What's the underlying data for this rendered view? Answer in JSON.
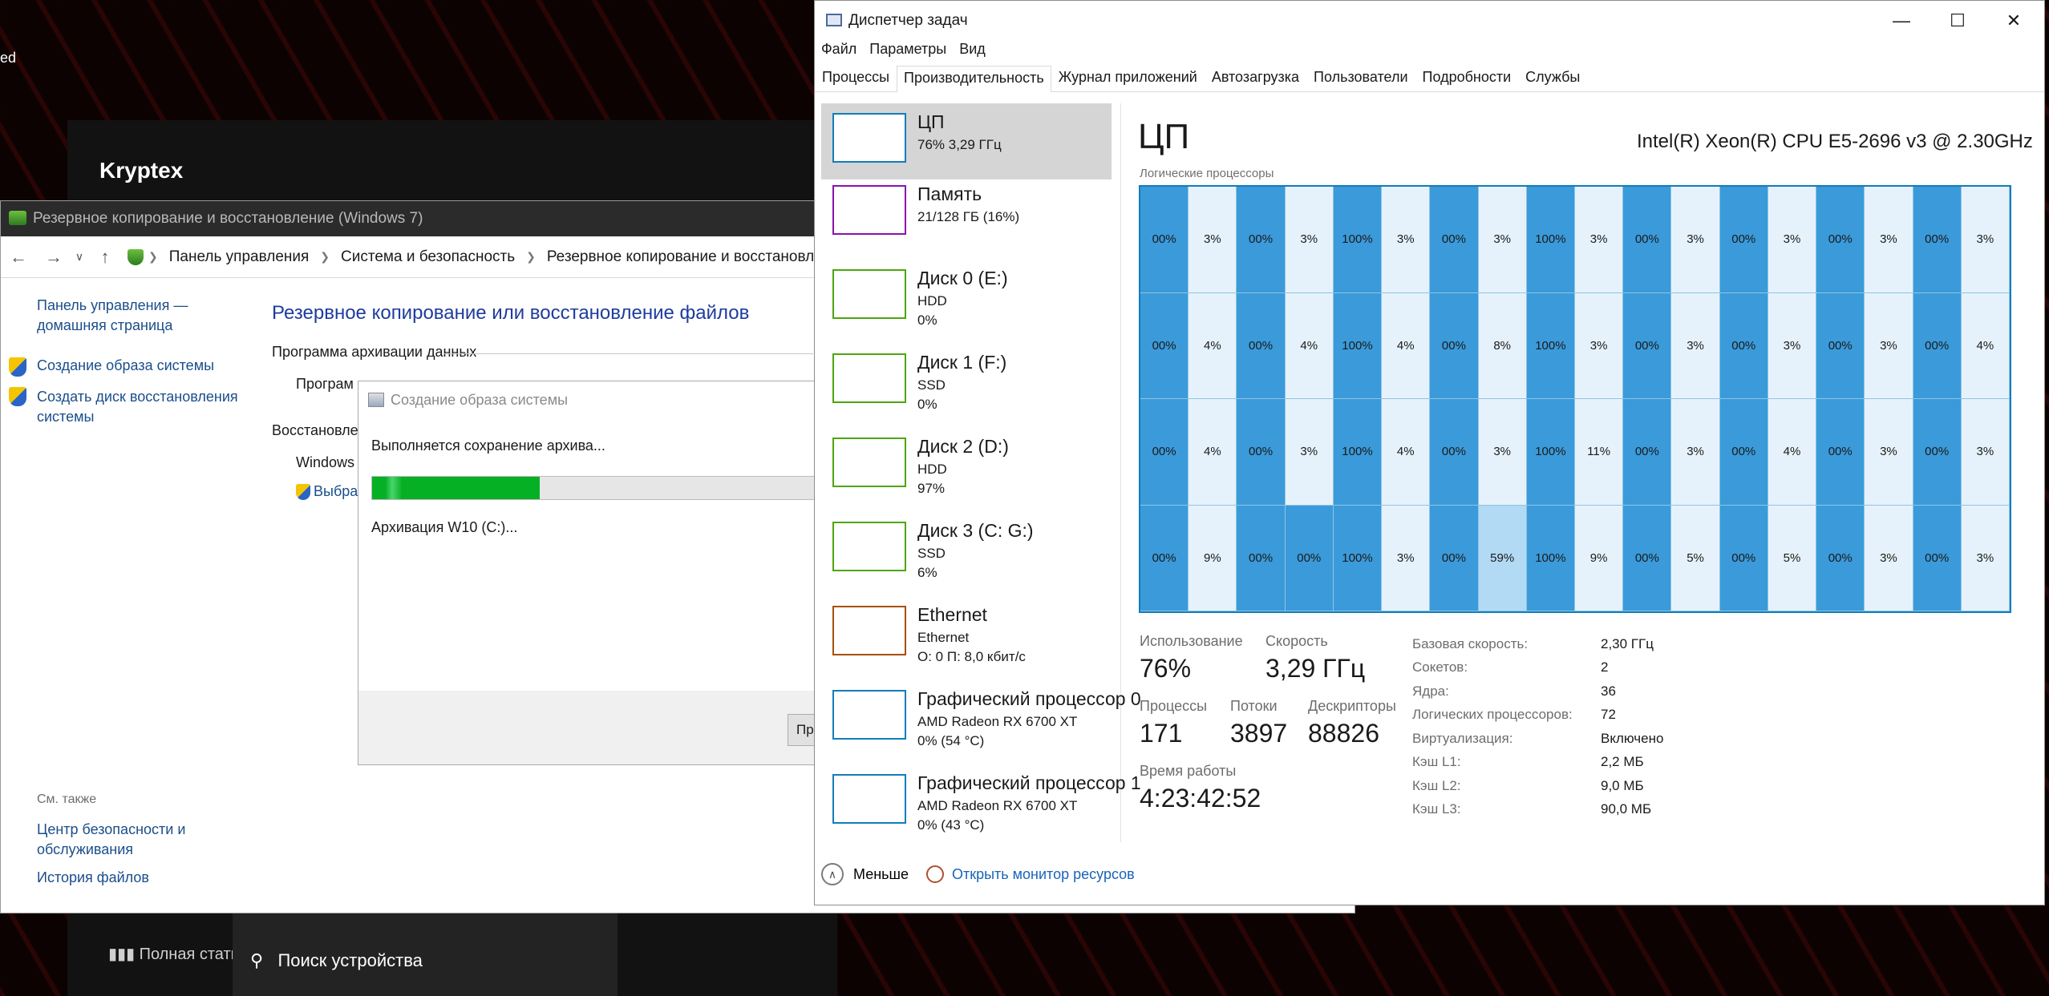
{
  "background": {
    "stray_text": "ed",
    "kryptex_title": "Kryptex",
    "kryptex_stat": "Полная стати",
    "kryptex_search": "Поиск устройства"
  },
  "control_panel": {
    "title": "Резервное копирование и восстановление (Windows 7)",
    "breadcrumbs": [
      "Панель управления",
      "Система и безопасность",
      "Резервное копирование и восстановление (W"
    ],
    "home_link": "Панель управления — домашняя страница",
    "task_links": [
      "Создание образа системы",
      "Создать диск восстановления системы"
    ],
    "heading": "Резервное копирование или восстановление файлов",
    "section_backup": "Программа архивации данных",
    "backup_line": "Програм",
    "section_restore": "Восстановлен",
    "restore_line": "Windows",
    "restore_link": "Выбра",
    "see_also": "См. также",
    "see_also_links": [
      "Центр безопасности и обслуживания",
      "История файлов"
    ]
  },
  "dialog": {
    "title": "Создание образа системы",
    "message": "Выполняется сохранение архива...",
    "progress": 0.35,
    "status": "Архивация W10 (C:)...",
    "button": "Пр"
  },
  "task_manager": {
    "title": "Диспетчер задач",
    "menu": [
      "Файл",
      "Параметры",
      "Вид"
    ],
    "tabs": [
      "Процессы",
      "Производительность",
      "Журнал приложений",
      "Автозагрузка",
      "Пользователи",
      "Подробности",
      "Службы"
    ],
    "active_tab": 1,
    "resources": [
      {
        "name": "ЦП",
        "l1": "76%  3,29 ГГц",
        "l2": "",
        "color": "#117dbb"
      },
      {
        "name": "Память",
        "l1": "21/128 ГБ (16%)",
        "l2": "",
        "color": "#8b12ae"
      },
      {
        "name": "Диск 0 (E:)",
        "l1": "HDD",
        "l2": "0%",
        "color": "#4da60c"
      },
      {
        "name": "Диск 1 (F:)",
        "l1": "SSD",
        "l2": "0%",
        "color": "#4da60c"
      },
      {
        "name": "Диск 2 (D:)",
        "l1": "HDD",
        "l2": "97%",
        "color": "#4da60c"
      },
      {
        "name": "Диск 3 (C: G:)",
        "l1": "SSD",
        "l2": "6%",
        "color": "#4da60c"
      },
      {
        "name": "Ethernet",
        "l1": "Ethernet",
        "l2": "О: 0  П: 8,0 кбит/с",
        "color": "#a74f01"
      },
      {
        "name": "Графический процессор 0",
        "l1": "AMD Radeon RX 6700 XT",
        "l2": "0%  (54 °C)",
        "color": "#117dbb"
      },
      {
        "name": "Графический процессор 1",
        "l1": "AMD Radeon RX 6700 XT",
        "l2": "0%  (43 °C)",
        "color": "#117dbb"
      }
    ],
    "cpu": {
      "header": "ЦП",
      "model": "Intel(R) Xeon(R) CPU E5-2696 v3 @ 2.30GHz",
      "grid_label": "Логические процессоры",
      "cores": [
        [
          "00%",
          "3%",
          "00%",
          "3%",
          "100%",
          "3%",
          "00%",
          "3%",
          "100%",
          "3%",
          "00%",
          "3%",
          "00%",
          "3%",
          "00%",
          "3%",
          "00%",
          "3%"
        ],
        [
          "00%",
          "4%",
          "00%",
          "4%",
          "100%",
          "4%",
          "00%",
          "8%",
          "100%",
          "3%",
          "00%",
          "3%",
          "00%",
          "3%",
          "00%",
          "3%",
          "00%",
          "4%"
        ],
        [
          "00%",
          "4%",
          "00%",
          "3%",
          "100%",
          "4%",
          "00%",
          "3%",
          "100%",
          "11%",
          "00%",
          "3%",
          "00%",
          "4%",
          "00%",
          "3%",
          "00%",
          "3%"
        ],
        [
          "00%",
          "9%",
          "00%",
          "00%",
          "100%",
          "3%",
          "00%",
          "59%",
          "100%",
          "9%",
          "00%",
          "5%",
          "00%",
          "5%",
          "00%",
          "3%",
          "00%",
          "3%"
        ]
      ],
      "usage_label": "Использование",
      "usage": "76%",
      "speed_label": "Скорость",
      "speed": "3,29 ГГц",
      "proc_label": "Процессы",
      "proc": "171",
      "threads_label": "Потоки",
      "threads": "3897",
      "handles_label": "Дескрипторы",
      "handles": "88826",
      "uptime_label": "Время работы",
      "uptime": "4:23:42:52",
      "info": [
        [
          "Базовая скорость:",
          "2,30 ГГц"
        ],
        [
          "Сокетов:",
          "2"
        ],
        [
          "Ядра:",
          "36"
        ],
        [
          "Логических процессоров:",
          "72"
        ],
        [
          "Виртуализация:",
          "Включено"
        ],
        [
          "Кэш L1:",
          "2,2 МБ"
        ],
        [
          "Кэш L2:",
          "9,0 МБ"
        ],
        [
          "Кэш L3:",
          "90,0 МБ"
        ]
      ]
    },
    "footer": {
      "less": "Меньше",
      "resmon": "Открыть монитор ресурсов"
    }
  }
}
